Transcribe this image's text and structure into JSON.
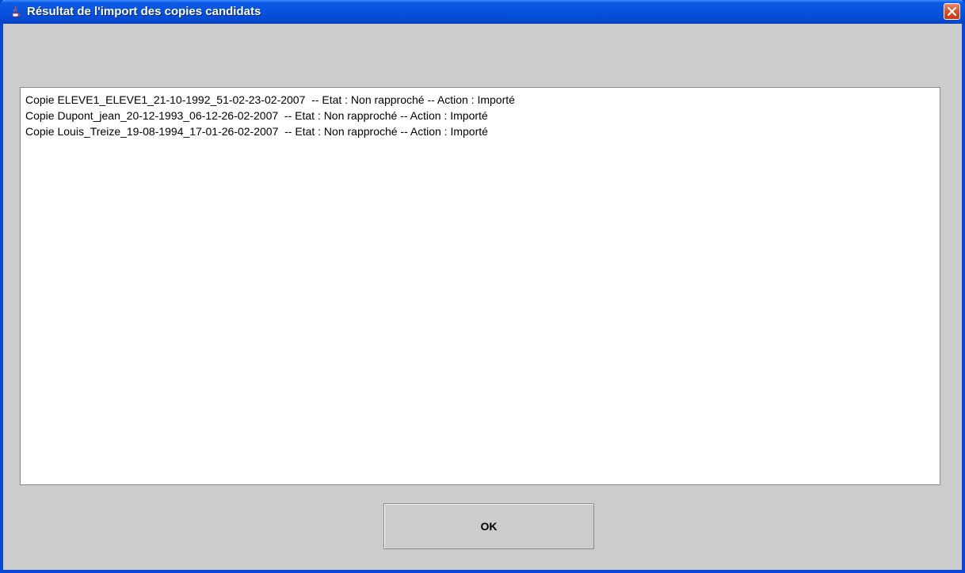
{
  "window": {
    "title": "Résultat de l'import des copies candidats",
    "icon": "java-cup-icon",
    "close_icon": "close-icon"
  },
  "log": {
    "lines": [
      "Copie ELEVE1_ELEVE1_21-10-1992_51-02-23-02-2007  -- Etat : Non rapproché -- Action : Importé",
      "Copie Dupont_jean_20-12-1993_06-12-26-02-2007  -- Etat : Non rapproché -- Action : Importé",
      "Copie Louis_Treize_19-08-1994_17-01-26-02-2007  -- Etat : Non rapproché -- Action : Importé"
    ]
  },
  "buttons": {
    "ok_label": "OK"
  },
  "colors": {
    "titlebar": "#0653e0",
    "close_button": "#e0502a",
    "background": "#cccccc"
  }
}
